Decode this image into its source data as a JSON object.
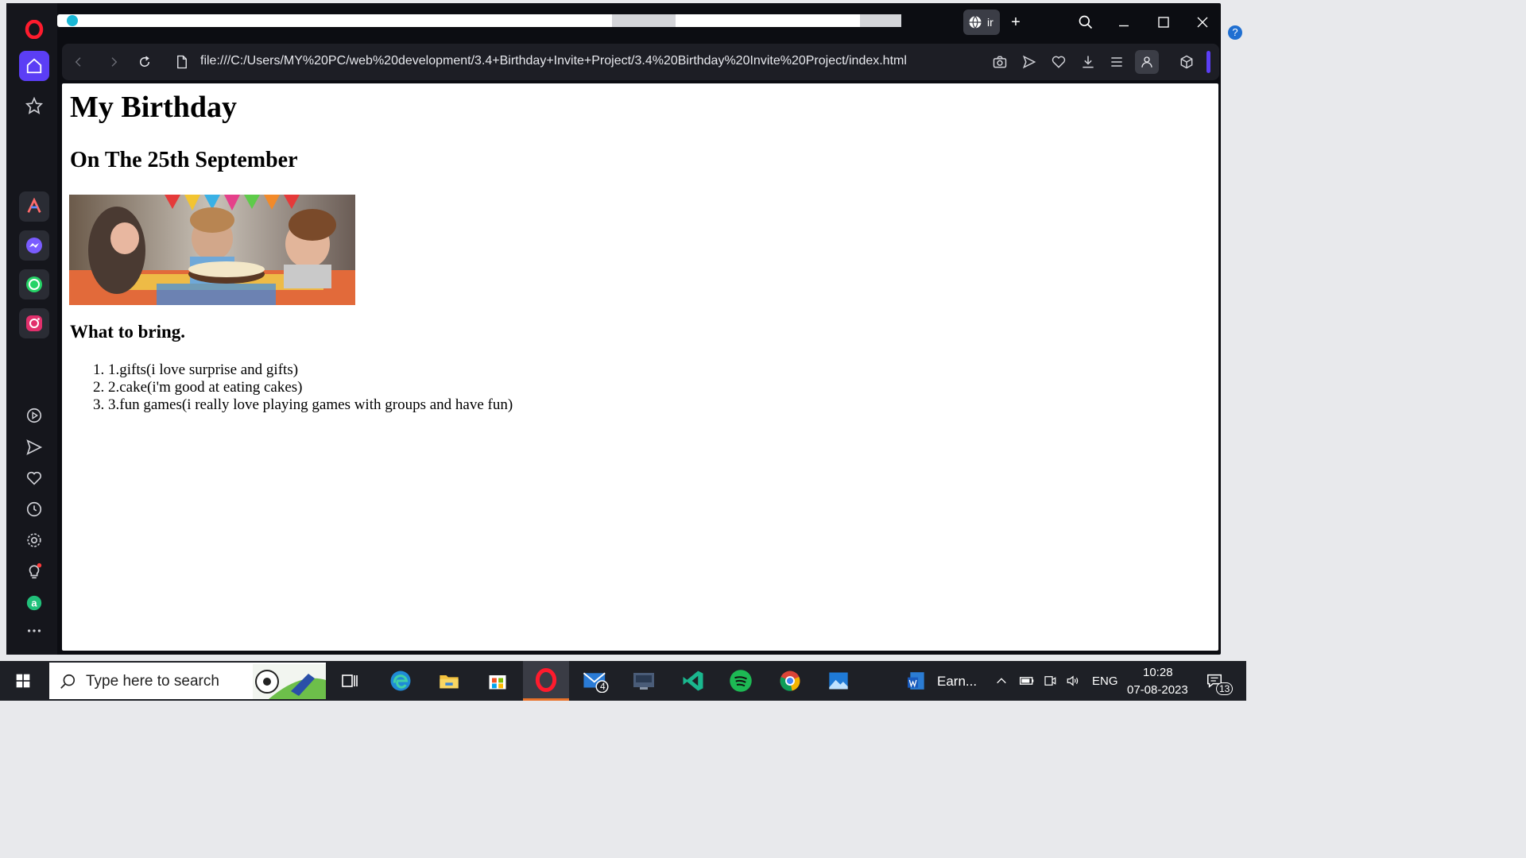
{
  "browser": {
    "name": "Opera",
    "active_tab_label": "ir",
    "new_tab_label": "+",
    "url": "file:///C:/Users/MY%20PC/web%20development/3.4+Birthday+Invite+Project/3.4%20Birthday%20Invite%20Project/index.html",
    "sidebar_items": [
      "home-icon",
      "star-icon",
      "aria-icon",
      "messenger-icon",
      "whatsapp-icon",
      "instagram-icon",
      "player-icon",
      "send-icon",
      "heart-icon",
      "history-icon",
      "settings-icon",
      "tips-icon",
      "app-icon",
      "more-icon"
    ],
    "colors": {
      "accent": "#5b3ef5",
      "frame": "#0c0d12",
      "sidebar": "#15161c"
    }
  },
  "page": {
    "title": "My Birthday",
    "subtitle": "On The 25th September",
    "image_alt": "kids-birthday-party-photo",
    "bring_heading": "What to bring.",
    "bring_items": [
      "1.gifts(i love surprise and gifts)",
      "2.cake(i'm good at eating cakes)",
      "3.fun games(i really love playing games with groups and have fun)"
    ]
  },
  "taskbar": {
    "search_placeholder": "Type here to search",
    "mail_badge": "4",
    "word_label": "Earn...",
    "language": "ENG",
    "time": "10:28",
    "date": "07-08-2023",
    "notifications": "13"
  }
}
